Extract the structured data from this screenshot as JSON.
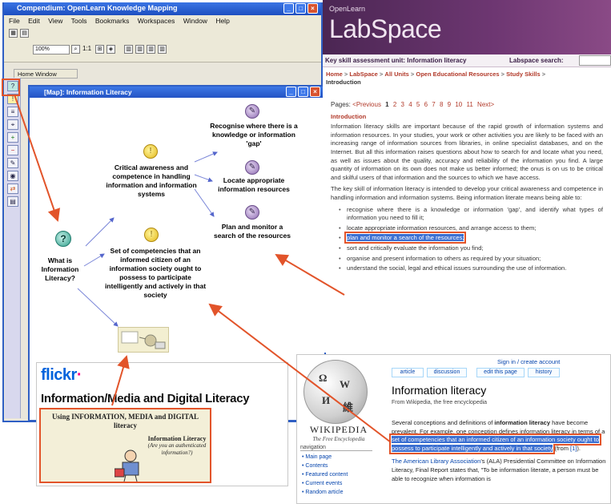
{
  "compendium": {
    "title": "Compendium: OpenLearn Knowledge Mapping",
    "menu": [
      "File",
      "Edit",
      "View",
      "Tools",
      "Bookmarks",
      "Workspaces",
      "Window",
      "Help"
    ],
    "zoom": "100%",
    "home_tab": "Home Window",
    "map_title": "[Map]: Information Literacy",
    "nodes": {
      "root": "What is Information Literacy?",
      "awareness": "Critical awareness and competence in handling information and information systems",
      "competencies": "Set of competencies that an informed citizen of an information society ought to possess to participate intelligently and actively in that society",
      "recognise": "Recognise where there is a knowledge or information 'gap'",
      "locate": "Locate appropriate information resources",
      "plan": "Plan and monitor a search of the resources"
    }
  },
  "flickr": {
    "logo": "flickr",
    "heading": "Information/Media and Digital Literacy",
    "image_title": "Using INFORMATION, MEDIA and DIGITAL literacy",
    "image_sub_title": "Information Literacy",
    "image_sub_text": "(Are you an authenticated information?)"
  },
  "labspace": {
    "openlearn": "OpenLearn",
    "logo": "LabSpace",
    "unit_title": "Key skill assessment unit: Information literacy",
    "search_label": "Labspace search:",
    "breadcrumb": [
      "Home",
      "LabSpace",
      "All Units",
      "Open Educational Resources",
      "Study Skills"
    ],
    "breadcrumb_current": "Introduction",
    "pages_label": "Pages:",
    "prev": "<Previous",
    "pages": [
      "1",
      "2",
      "3",
      "4",
      "5",
      "6",
      "7",
      "8",
      "9",
      "10",
      "11"
    ],
    "next": "Next>",
    "section": "Introduction",
    "para1": "Information literacy skills are important because of the rapid growth of information systems and information resources. In your studies, your work or other activities you are likely to be faced with an increasing range of information sources from libraries, in online specialist databases, and on the Internet. But all this information raises questions about how to search for and locate what you need, as well as issues about the quality, accuracy and reliability of the information you find. A large quantity of information on its own does not make us better informed; the onus is on us to be critical and skilful users of that information and the sources to which we have access.",
    "para2": "The key skill of information literacy is intended to develop your critical awareness and competence in handling information and information systems. Being information literate means being able to:",
    "bullets": [
      "recognise where there is a knowledge or information 'gap', and identify what types of information you need to fill it;",
      "locate appropriate information resources, and arrange access to them;",
      "plan and monitor a search of the resources;",
      "sort and critically evaluate the information you find;",
      "organise and present information to others as required by your situation;",
      "understand the social, legal and ethical issues surrounding the use of information."
    ]
  },
  "wikipedia": {
    "account": "Sign in / create account",
    "tabs": [
      "article",
      "discussion",
      "edit this page",
      "history"
    ],
    "wordmark": "WIKIPEDIA",
    "tagline": "The Free Encyclopedia",
    "nav_heading": "navigation",
    "nav": [
      "Main page",
      "Contents",
      "Featured content",
      "Current events",
      "Random article"
    ],
    "title": "Information literacy",
    "from": "From Wikipedia, the free encyclopedia",
    "p1_start": "Several conceptions and definitions of ",
    "p1_bold": "information literacy",
    "p1_mid": " have become prevalent. For example, one conception defines information literacy in terms of a ",
    "p1_highlight": "set of competencies that an informed citizen of an information society ought to possess to participate intelligently and actively in that society",
    "p1_end": " (from ",
    "p1_cite": "[1]",
    "p1_close": ").",
    "p2_link": "The American Library Association",
    "p2_text": "'s (ALA) Presidential Committee on Information Literacy, Final Report states that, \"To be information literate, a person must be able to recognize when information is"
  }
}
